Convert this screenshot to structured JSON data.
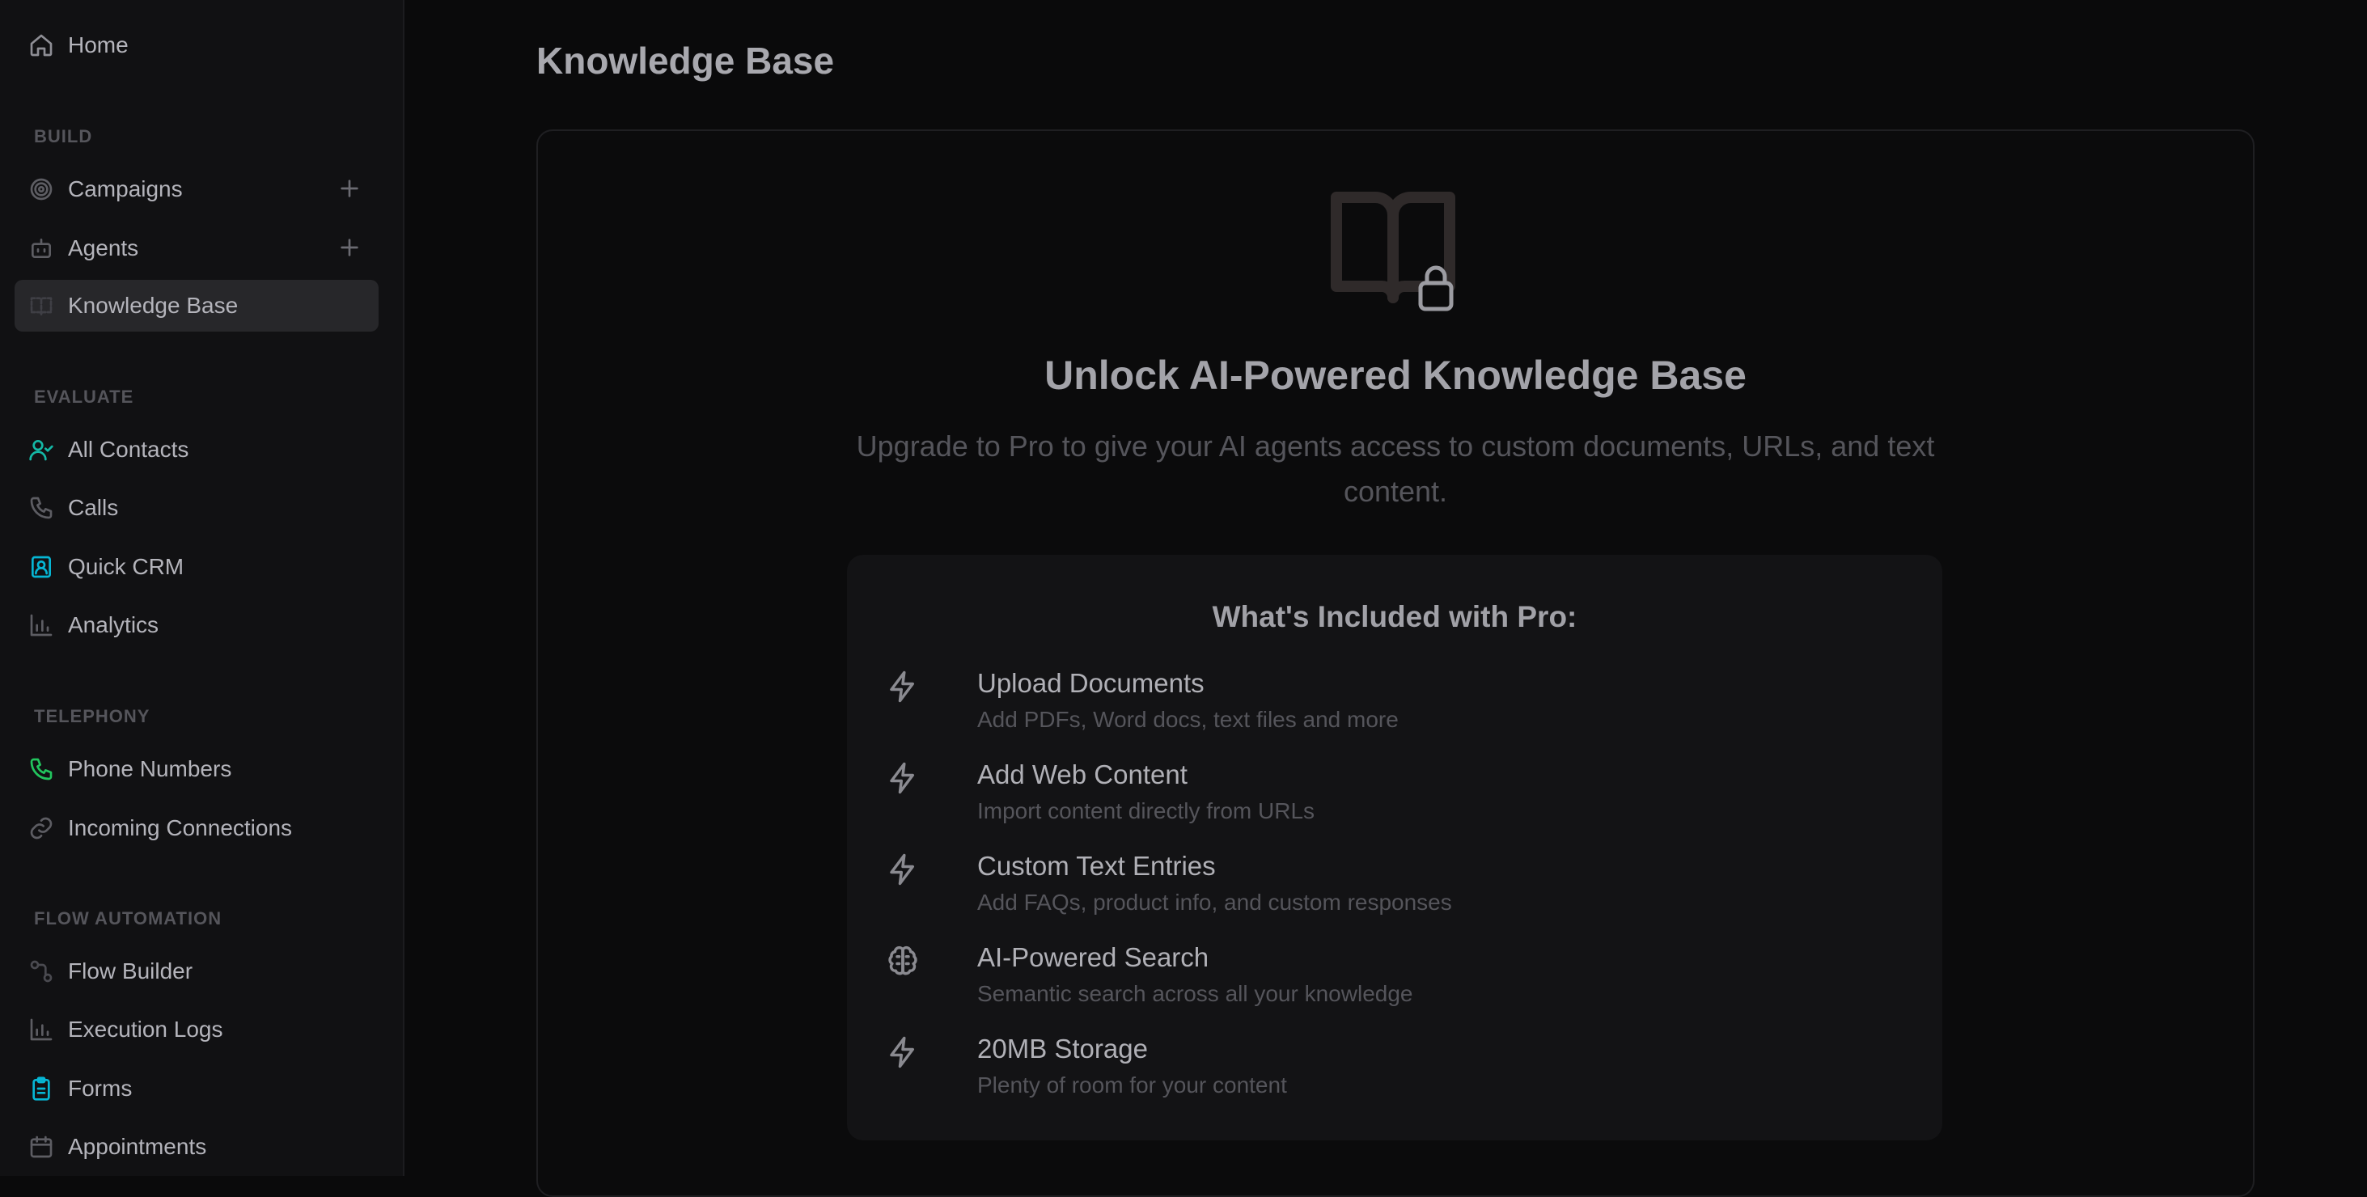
{
  "sidebar": {
    "home": "Home",
    "sections": {
      "build": "BUILD",
      "evaluate": "EVALUATE",
      "telephony": "TELEPHONY",
      "flow_automation": "FLOW AUTOMATION"
    },
    "items": {
      "campaigns": "Campaigns",
      "agents": "Agents",
      "knowledge_base": "Knowledge Base",
      "all_contacts": "All Contacts",
      "calls": "Calls",
      "quick_crm": "Quick CRM",
      "analytics": "Analytics",
      "phone_numbers": "Phone Numbers",
      "incoming_connections": "Incoming Connections",
      "flow_builder": "Flow Builder",
      "execution_logs": "Execution Logs",
      "forms": "Forms",
      "appointments": "Appointments"
    },
    "active_item": "knowledge_base",
    "icons": {
      "home": "home-icon",
      "campaigns": "target-icon",
      "agents": "bot-icon",
      "knowledge_base": "book-icon",
      "all_contacts": "user-check-icon",
      "calls": "phone-icon",
      "quick_crm": "contact-card-icon",
      "analytics": "bar-chart-icon",
      "phone_numbers": "phone-icon",
      "incoming_connections": "link-icon",
      "flow_builder": "workflow-icon",
      "execution_logs": "bar-chart-icon",
      "forms": "clipboard-icon",
      "appointments": "calendar-icon"
    }
  },
  "main": {
    "page_title": "Knowledge Base",
    "unlock_title": "Unlock AI-Powered Knowledge Base",
    "unlock_subtitle": "Upgrade to Pro to give your AI agents access to custom documents, URLs, and text content.",
    "pro_box": {
      "title": "What's Included with Pro:",
      "features": [
        {
          "title": "Upload Documents",
          "description": "Add PDFs, Word docs, text files and more",
          "icon": "zap-icon"
        },
        {
          "title": "Add Web Content",
          "description": "Import content directly from URLs",
          "icon": "zap-icon"
        },
        {
          "title": "Custom Text Entries",
          "description": "Add FAQs, product info, and custom responses",
          "icon": "zap-icon"
        },
        {
          "title": "AI-Powered Search",
          "description": "Semantic search across all your knowledge",
          "icon": "brain-icon"
        },
        {
          "title": "20MB Storage",
          "description": "Plenty of room for your content",
          "icon": "zap-icon"
        }
      ]
    }
  },
  "colors": {
    "background": "#0a0a0b",
    "sidebar_bg": "#111113",
    "active_item_bg": "#27272a",
    "accent_teal": "#14b8a6",
    "accent_green": "#22c55e",
    "accent_cyan": "#06b6d4"
  }
}
